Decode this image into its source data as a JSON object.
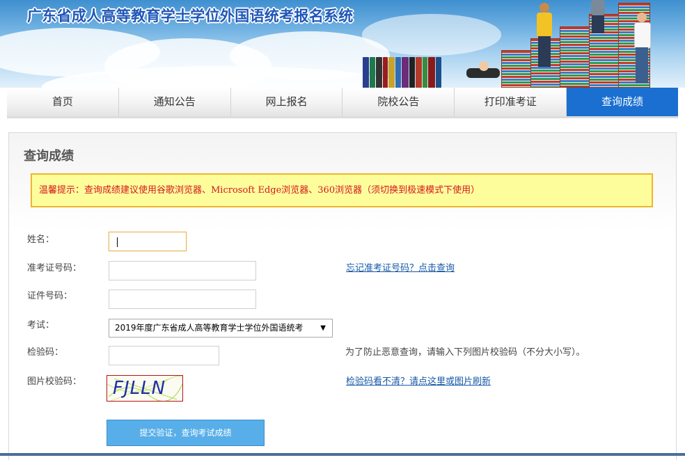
{
  "header": {
    "title": "广东省成人高等教育学士学位外国语统考报名系统"
  },
  "nav": {
    "items": [
      "首页",
      "通知公告",
      "网上报名",
      "院校公告",
      "打印准考证",
      "查询成绩"
    ],
    "active_index": 5
  },
  "main": {
    "title": "查询成绩",
    "notice": "温馨提示：查询成绩建议使用谷歌浏览器、Microsoft Edge浏览器、360浏览器（须切换到极速模式下使用）",
    "form": {
      "name_label": "姓名：",
      "name_value": "",
      "ticket_label": "准考证号码：",
      "ticket_value": "",
      "forgot_link": "忘记准考证号码？点击查询",
      "id_label": "证件号码：",
      "id_value": "",
      "exam_label": "考试：",
      "exam_selected": "2019年度广东省成人高等教育学士学位外国语统考",
      "code_label": "检验码：",
      "code_value": "",
      "code_hint": "为了防止恶意查询，请输入下列图片校验码（不分大小写）。",
      "captcha_label": "图片校验码：",
      "captcha_text": "FJLLN",
      "refresh_link": "检验码看不清？请点这里或图片刷新",
      "submit_label": "提交验证，查询考试成绩"
    }
  },
  "colors": {
    "nav_active": "#1a6fd1",
    "title_blue": "#1f57b8",
    "notice_bg": "#fdfd9c",
    "notice_border": "#f0b429",
    "notice_text": "#d6181b",
    "submit_bg": "#57aee8",
    "link": "#1558a8"
  }
}
